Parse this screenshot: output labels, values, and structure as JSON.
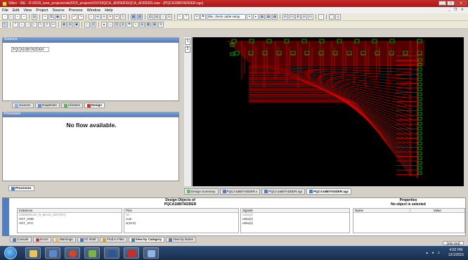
{
  "window": {
    "title": "Xilinx - ISE - D:\\2015_ieee_projects\\vlsi2015_projects\\15VSI\\QCA_ADDERS\\QCA_ADDERS.xise - [PQCA16BITADDER.ngc]",
    "min": "_",
    "max": "□",
    "close": "✕",
    "mdi_controls": "_ ❐ ✕"
  },
  "menu": [
    "File",
    "Edit",
    "View",
    "Project",
    "Source",
    "Process",
    "Window",
    "Help"
  ],
  "toolbar": {
    "search_select": "ible, check cable setup"
  },
  "sources": {
    "header": "Sources",
    "tree_item": "PQCA16BITADDER",
    "tabs": [
      "Sources",
      "Snapshots",
      "Libraries",
      "Design"
    ]
  },
  "processes": {
    "header": "Processes",
    "empty_message": "No flow available.",
    "tab": "Processes"
  },
  "ruler": {
    "pages": [
      "1",
      "2"
    ]
  },
  "doc_tabs": [
    "Design Summary",
    "PQCA16BITADDER.v",
    "PQCA16BITADDER.ngr",
    "PQCA16BITADDER.ngc"
  ],
  "design_objects": {
    "title_line1": "Design Objects of",
    "title_line2": "PQCA16BITADDER",
    "instances": {
      "header": "Instances",
      "rows": [
        "USMKMAJU_N_MAJU_SDY(SY)",
        "XST_GND",
        "XST_VCC"
      ]
    },
    "pins": {
      "header": "Pins",
      "rows": [
        "cin",
        "cout",
        "s(15:0)"
      ]
    },
    "signals": {
      "header": "Signals",
      "rows": [
        "u4/w(2)",
        "u5/w(2)",
        "u6/w(2)"
      ]
    }
  },
  "properties": {
    "title_line1": "Properties",
    "title_line2": "No object is selected",
    "col_name": "Name",
    "col_value": "Value"
  },
  "console_tabs": [
    "Console",
    "Errors",
    "Warnings",
    "Tcl Shell",
    "Find in Files",
    "View by Category",
    "View by Name"
  ],
  "status": {
    "coords": "[192,164]"
  },
  "taskbar": {
    "time": "4:52 PM",
    "date": "12/1/2015"
  },
  "colors": {
    "schematic_bg": "#000000",
    "wire": "#e00000",
    "component": "#00c000",
    "title_bar": "#b81f1f"
  }
}
